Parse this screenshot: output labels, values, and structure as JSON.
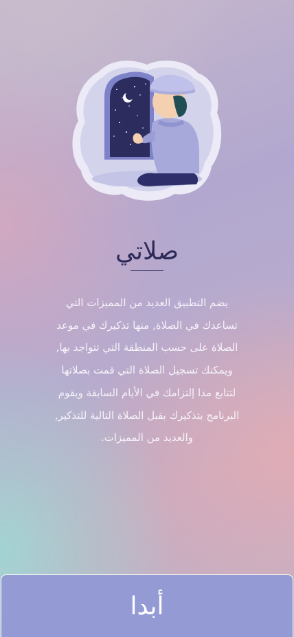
{
  "app": {
    "title": "صلاتي"
  },
  "onboarding": {
    "illustration_icon": "praying-boy-illustration",
    "description": "يضم التطبيق العديد من المميزات التي\nتساعدك في الصلاة, منها تذكيرك في موعد\nالصلاة على حسب المنطقة التي تتواجد بها,\nويمكنك تسجيل الصلاة التي قمت بصلاتها\nلتتابع مدا إلتزامك في الأيام السابقة ويقوم\nالبرنامج بتذكيرك بقبل الصلاة التالية للتذكير,\nوالعديد من المميزات."
  },
  "actions": {
    "start_label": "أبدا"
  },
  "colors": {
    "title": "#2d2a5a",
    "description_text": "#f6f3fa",
    "button_background": "#939ad4",
    "button_text": "#ffffff"
  }
}
